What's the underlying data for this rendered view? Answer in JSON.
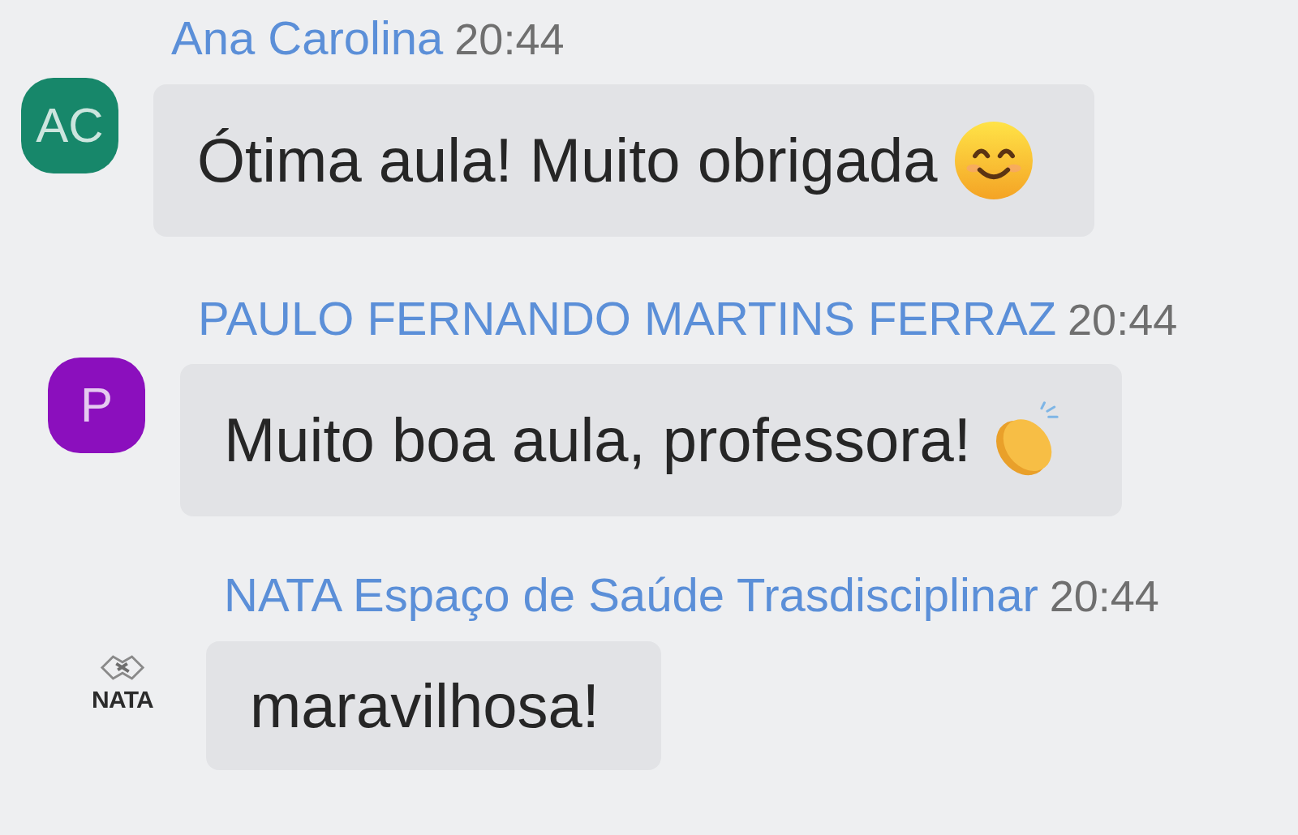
{
  "messages": [
    {
      "sender": "Ana Carolina",
      "time": "20:44",
      "avatar": {
        "kind": "initials",
        "text": "AC",
        "color": "#17876a"
      },
      "text": "Ótima aula! Muito obrigada",
      "emoji": {
        "kind": "smile"
      }
    },
    {
      "sender": "PAULO FERNANDO MARTINS FERRAZ",
      "time": "20:44",
      "avatar": {
        "kind": "initials",
        "text": "P",
        "color": "#8b0fbd"
      },
      "text": "Muito boa aula, professora!",
      "emoji": {
        "kind": "clap"
      }
    },
    {
      "sender": "NATA Espaço de Saúde Trasdisciplinar",
      "time": "20:44",
      "avatar": {
        "kind": "logo",
        "text": "NATA"
      },
      "text": "maravilhosa!"
    }
  ]
}
